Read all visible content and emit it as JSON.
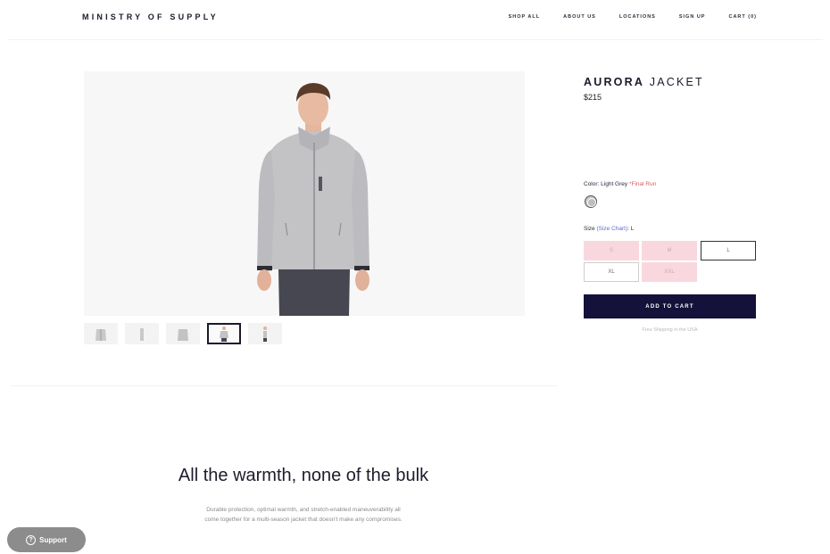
{
  "header": {
    "brand": "MINISTRY OF SUPPLY",
    "nav": [
      "SHOP ALL",
      "ABOUT US",
      "LOCATIONS",
      "SIGN UP",
      "CART (0)"
    ]
  },
  "product": {
    "title_bold": "AURORA",
    "title_light": "JACKET",
    "price": "$215",
    "color_label": "Color:",
    "color_value": "Light Grey",
    "color_note": "*Final Run",
    "size_label": "Size",
    "size_chart": "(Size Chart)",
    "size_selected": ": L",
    "sizes": [
      {
        "label": "S",
        "state": "sold"
      },
      {
        "label": "M",
        "state": "sold"
      },
      {
        "label": "L",
        "state": "selected"
      },
      {
        "label": "XL",
        "state": "available"
      },
      {
        "label": "XXL",
        "state": "sold"
      }
    ],
    "add_to_cart": "ADD TO CART",
    "shipping": "Free Shipping in the USA"
  },
  "gallery": {
    "thumb_count": 5,
    "active_index": 3
  },
  "feature": {
    "tagline": "All the warmth, none of the bulk",
    "desc_line1": "Durable protection, optimal warmth, and stretch-enabled maneuverability all",
    "desc_line2": "come together for a multi-season jacket that doesn't make any compromises."
  },
  "support": {
    "label": "Support"
  },
  "colors": {
    "accent": "#14123a",
    "sold_out": "#f8d8de",
    "final_run": "#e05a5a",
    "link": "#5a6bd0"
  }
}
